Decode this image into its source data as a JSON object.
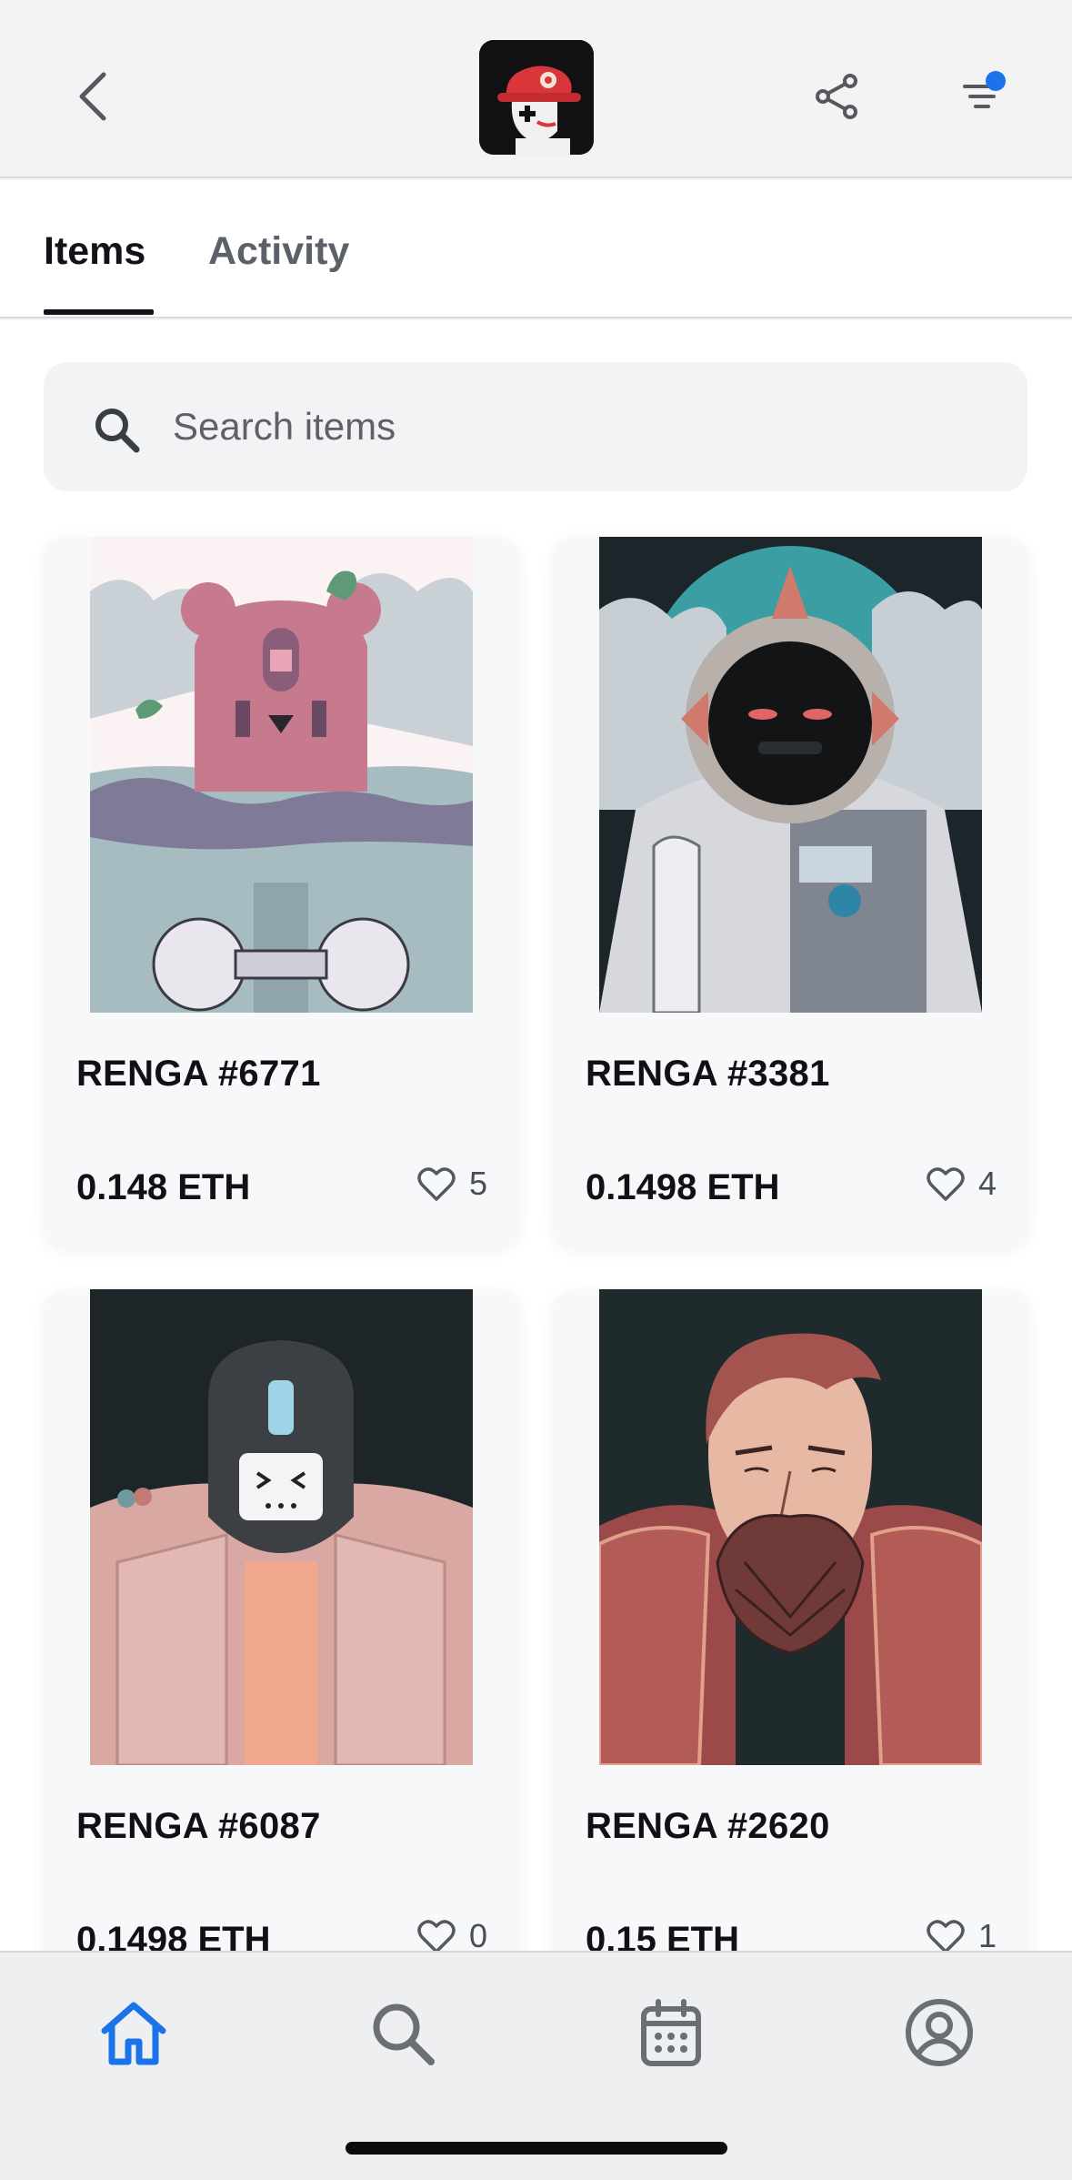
{
  "header": {
    "back_icon": "chevron-left-icon",
    "collection_avatar": "collection-avatar",
    "share_icon": "share-icon",
    "filter_icon": "filter-icon",
    "filter_badge_color": "#1a73e8"
  },
  "tabs": [
    {
      "label": "Items",
      "active": true
    },
    {
      "label": "Activity",
      "active": false
    }
  ],
  "search": {
    "placeholder": "Search items",
    "value": ""
  },
  "items": [
    {
      "title": "RENGA #6771",
      "price": "0.148 ETH",
      "likes": "5"
    },
    {
      "title": "RENGA #3381",
      "price": "0.1498 ETH",
      "likes": "4"
    },
    {
      "title": "RENGA #6087",
      "price": "0.1498 ETH",
      "likes": "0"
    },
    {
      "title": "RENGA #2620",
      "price": "0.15 ETH",
      "likes": "1"
    }
  ],
  "bottom_nav": [
    {
      "icon": "home-icon",
      "active": true
    },
    {
      "icon": "search-icon",
      "active": false
    },
    {
      "icon": "calendar-icon",
      "active": false
    },
    {
      "icon": "profile-icon",
      "active": false
    }
  ],
  "colors": {
    "accent": "#1a73e8",
    "text": "#0f1115",
    "muted": "#5c6068"
  }
}
